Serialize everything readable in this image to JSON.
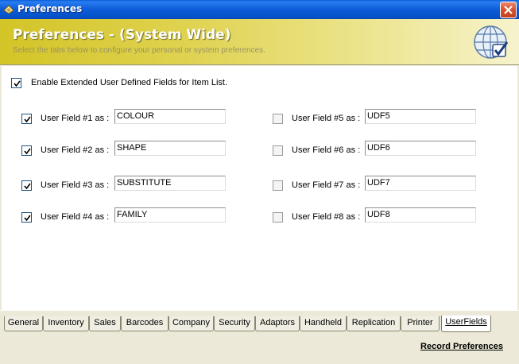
{
  "window": {
    "title": "Preferences"
  },
  "banner": {
    "title": "Preferences - (System Wide)",
    "subtitle": "Select the tabs below to configure your personal or system preferences."
  },
  "enable_extended": {
    "label": "Enable Extended User Defined Fields for Item List.",
    "checked": true
  },
  "fields": [
    {
      "label": "User Field #1 as :",
      "value": "COLOUR",
      "checked": true
    },
    {
      "label": "User Field #2 as :",
      "value": "SHAPE",
      "checked": true
    },
    {
      "label": "User Field #3 as :",
      "value": "SUBSTITUTE",
      "checked": true
    },
    {
      "label": "User Field #4 as :",
      "value": "FAMILY",
      "checked": true
    },
    {
      "label": "User Field #5 as :",
      "value": "UDF5",
      "checked": false
    },
    {
      "label": "User Field #6 as :",
      "value": "UDF6",
      "checked": false
    },
    {
      "label": "User Field #7 as :",
      "value": "UDF7",
      "checked": false
    },
    {
      "label": "User Field #8 as :",
      "value": "UDF8",
      "checked": false
    }
  ],
  "tabs": [
    {
      "label": "General"
    },
    {
      "label": "Inventory"
    },
    {
      "label": "Sales"
    },
    {
      "label": "Barcodes"
    },
    {
      "label": "Company"
    },
    {
      "label": "Security"
    },
    {
      "label": "Adaptors"
    },
    {
      "label": "Handheld"
    },
    {
      "label": "Replication"
    },
    {
      "label": "Printer"
    },
    {
      "label": "UserFields",
      "active": true
    }
  ],
  "footer": {
    "record_label": "Record Preferences"
  },
  "icons": {
    "app": "preferences-icon",
    "close": "close-icon",
    "banner": "globe-check-icon"
  },
  "colors": {
    "titlebar": "#0b5cd6",
    "banner_start": "#d3c427",
    "close": "#d8542f"
  }
}
